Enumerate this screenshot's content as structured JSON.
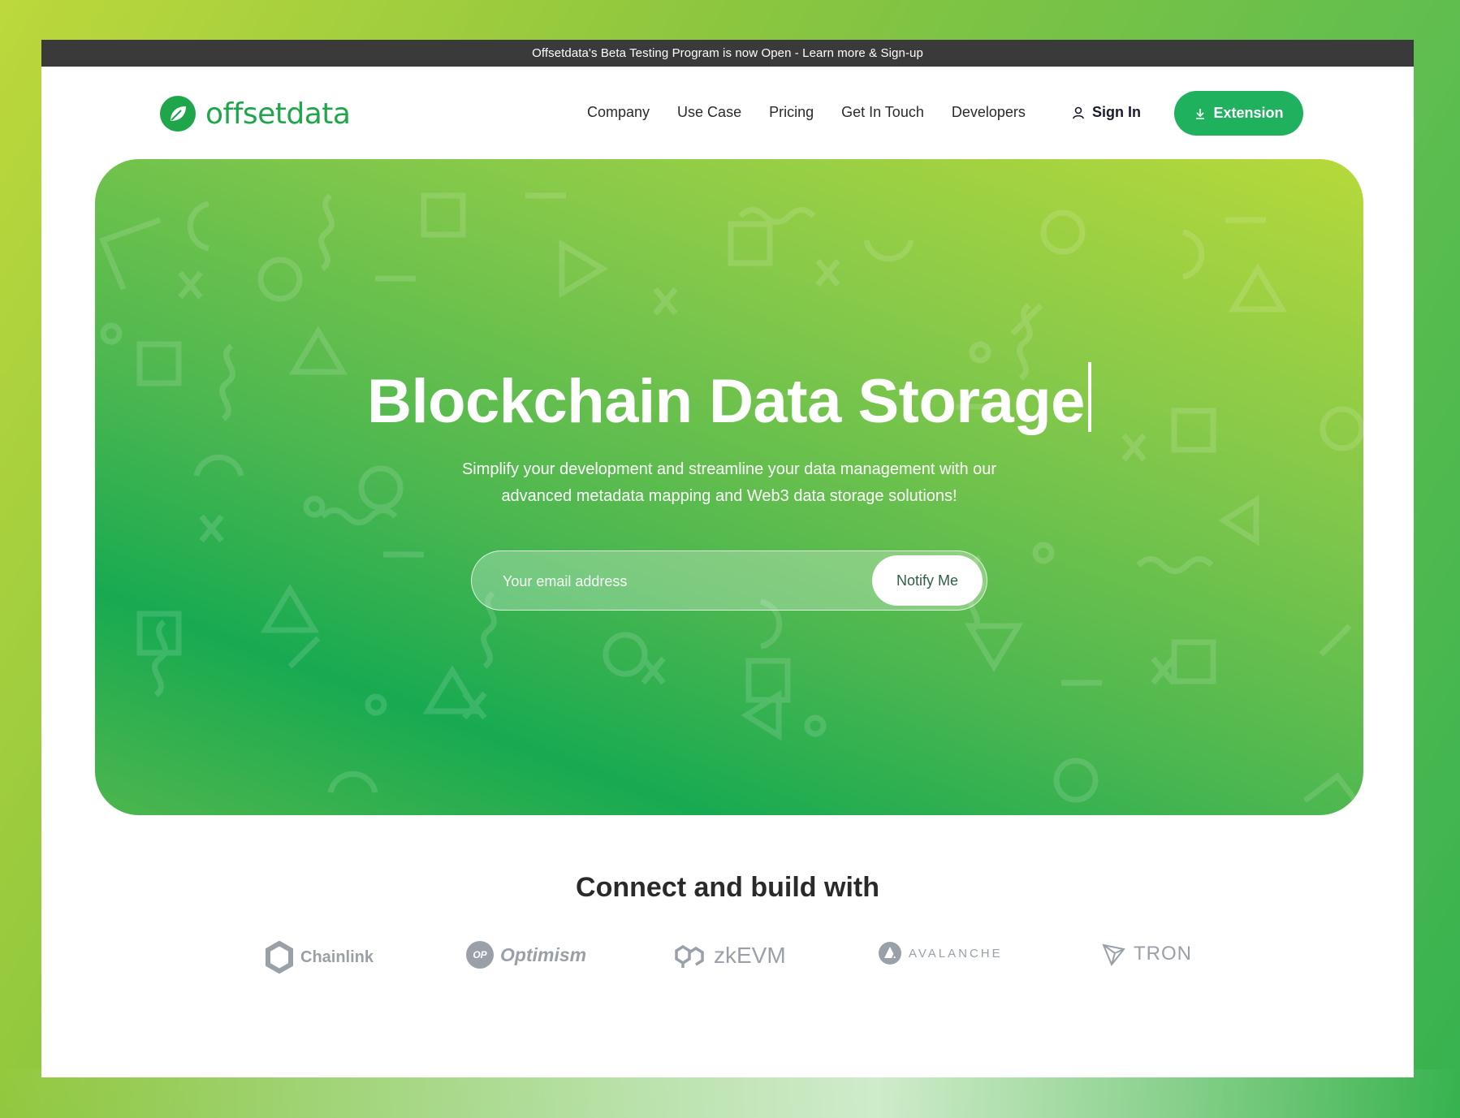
{
  "announcement": "Offsetdata's Beta Testing Program is now Open - Learn more & Sign-up",
  "brand": {
    "name": "offsetdata",
    "color": "#1fa64a"
  },
  "nav": {
    "links": [
      "Company",
      "Use Case",
      "Pricing",
      "Get In Touch",
      "Developers"
    ],
    "sign_in": "Sign In",
    "extension": "Extension"
  },
  "hero": {
    "title": "Blockchain Data Storage",
    "subtitle_line1": "Simplify your development and streamline your data management with our",
    "subtitle_line2": "advanced metadata mapping and Web3 data storage solutions!",
    "email_placeholder": "Your email address",
    "notify_label": "Notify Me"
  },
  "connect": {
    "title": "Connect and build with",
    "partners": [
      {
        "name": "Chainlink",
        "icon": "chainlink-hexagon-icon"
      },
      {
        "name": "Optimism",
        "icon": "optimism-op-icon",
        "badge": "OP"
      },
      {
        "name": "zkEVM",
        "icon": "polygon-icon"
      },
      {
        "name": "AVALANCHE",
        "icon": "avalanche-icon"
      },
      {
        "name": "TRON",
        "icon": "tron-icon"
      }
    ]
  },
  "colors": {
    "accent": "#20b15f",
    "announce_bg": "#3a3a3a",
    "partner_gray": "#9aa0a8"
  }
}
